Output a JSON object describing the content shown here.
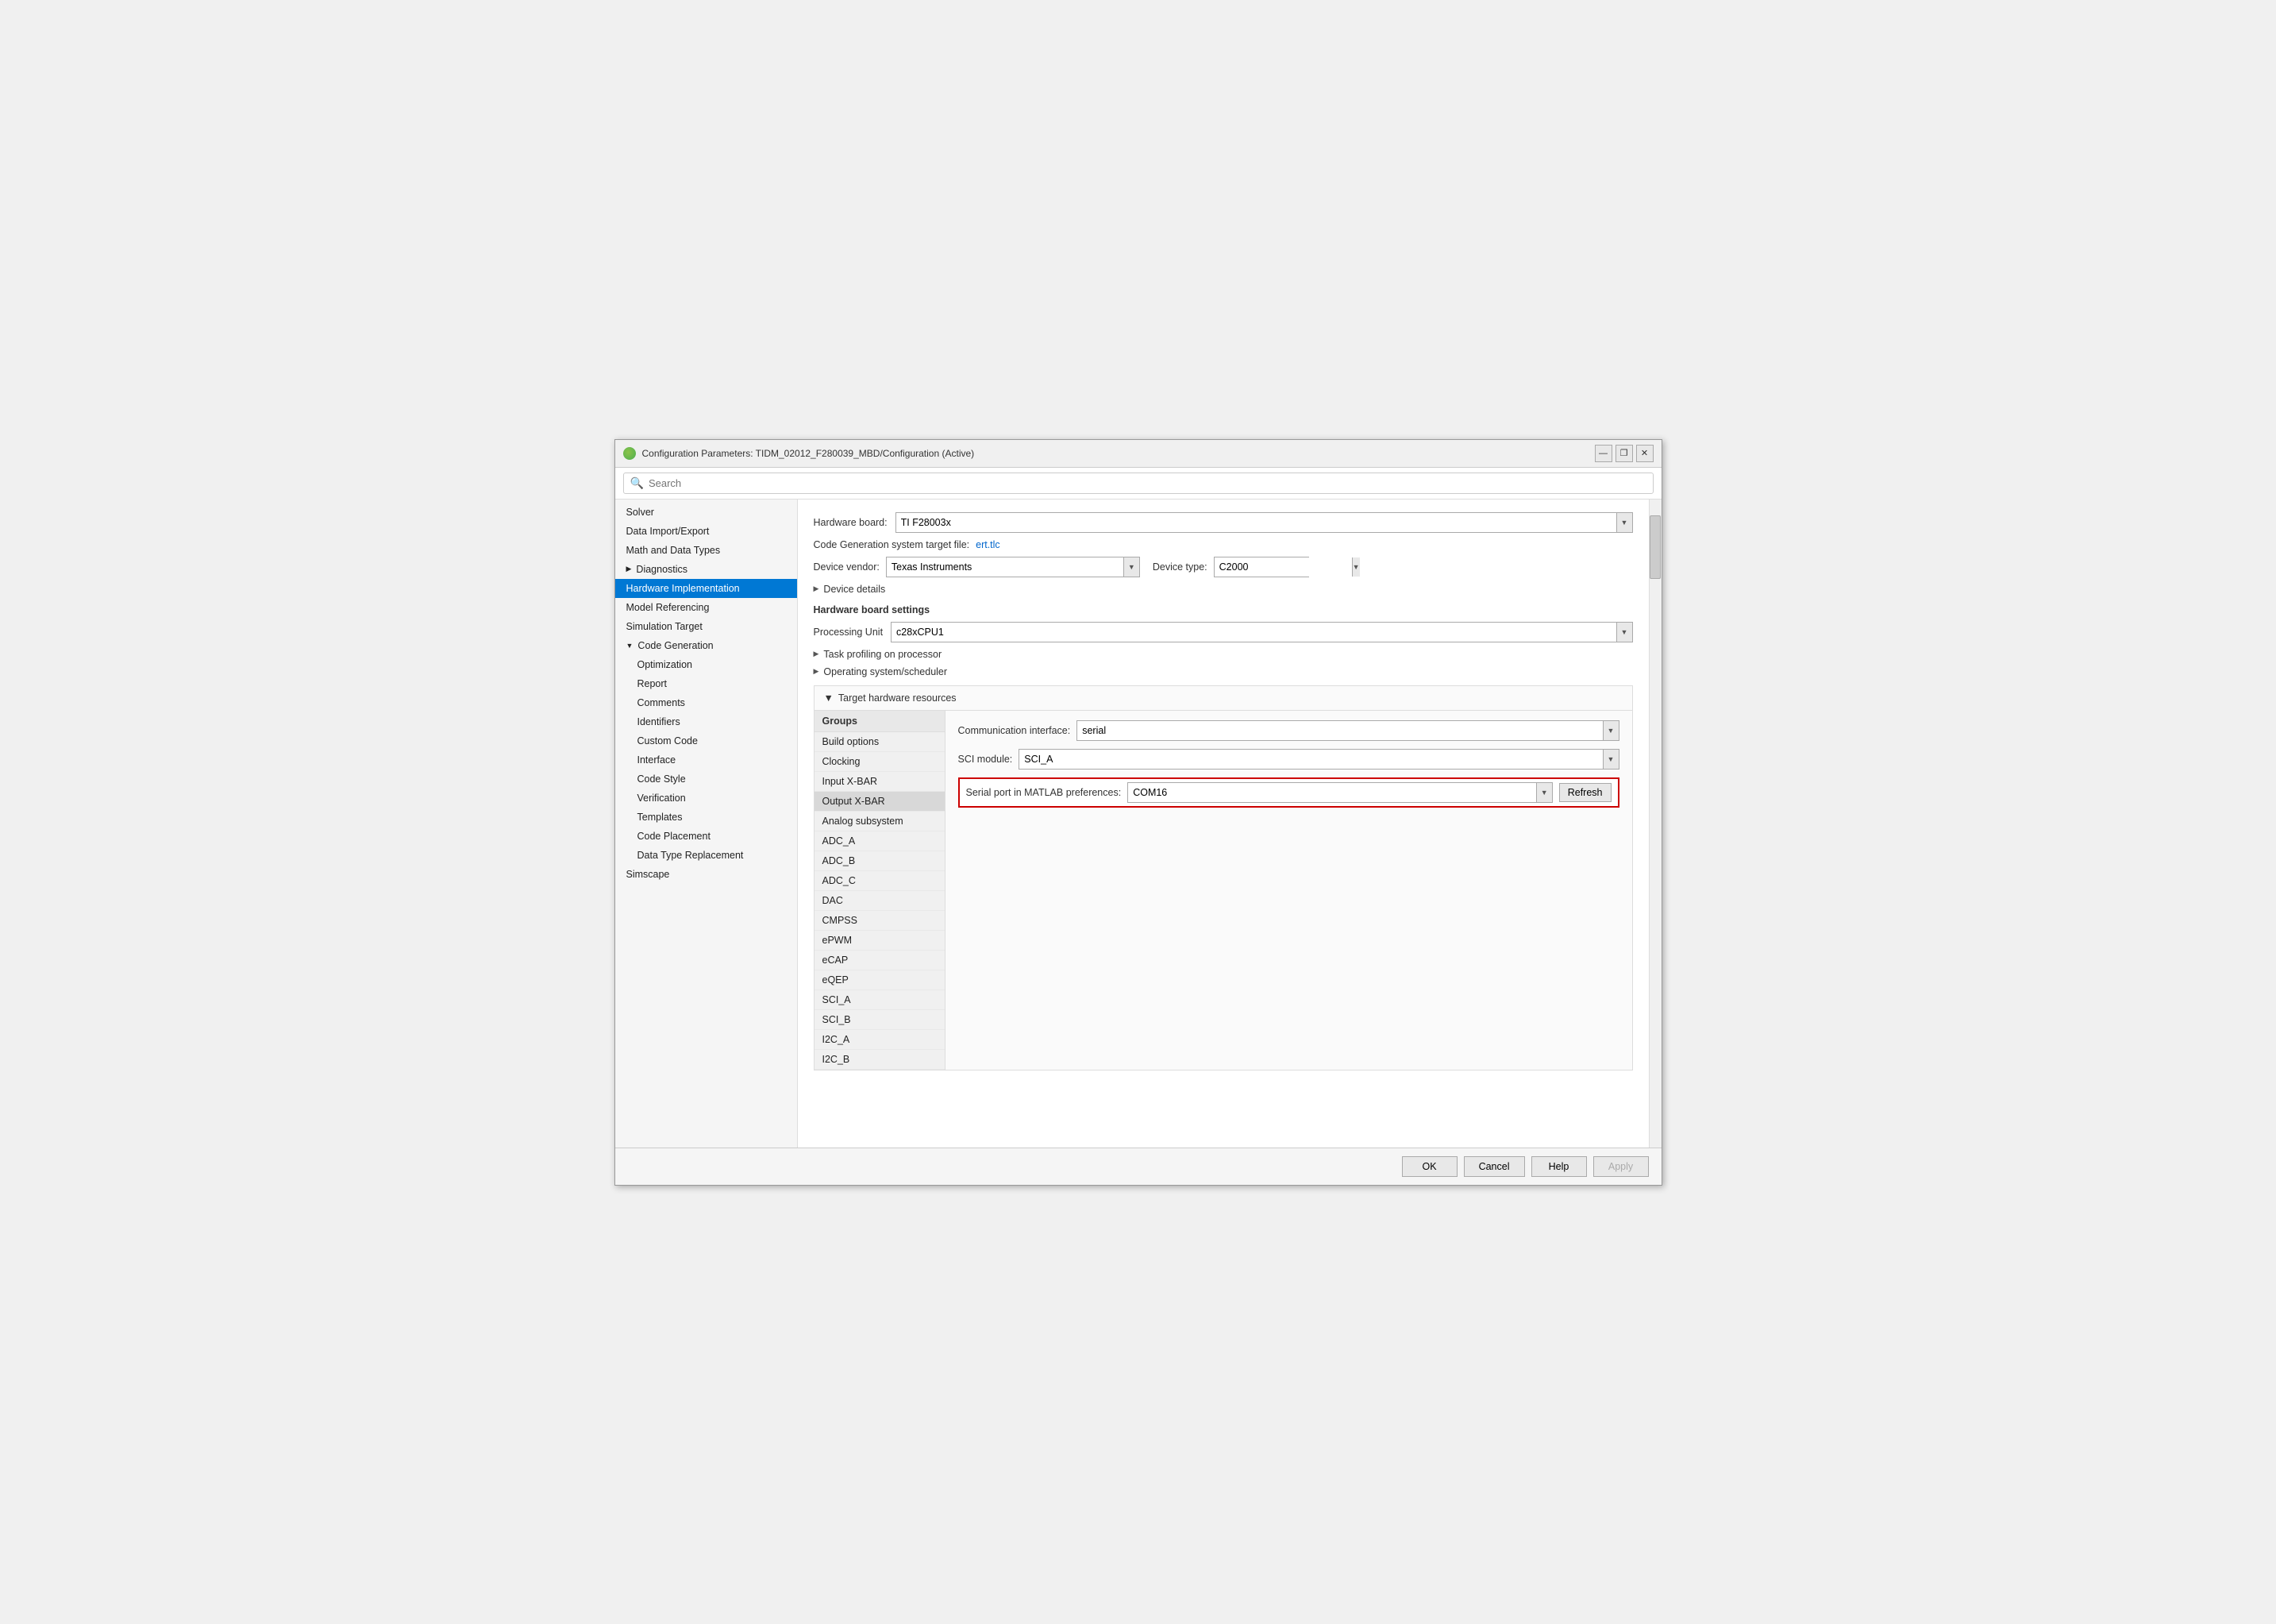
{
  "window": {
    "title": "Configuration Parameters: TIDM_02012_F280039_MBD/Configuration (Active)",
    "minimize": "—",
    "restore": "❐",
    "close": "✕"
  },
  "search": {
    "placeholder": "Search"
  },
  "sidebar": {
    "items": [
      {
        "id": "solver",
        "label": "Solver",
        "indent": 1,
        "active": false
      },
      {
        "id": "data-import-export",
        "label": "Data Import/Export",
        "indent": 1,
        "active": false
      },
      {
        "id": "math-data-types",
        "label": "Math and Data Types",
        "indent": 1,
        "active": false
      },
      {
        "id": "diagnostics",
        "label": "Diagnostics",
        "indent": 1,
        "active": false,
        "triangle": "▶"
      },
      {
        "id": "hardware-implementation",
        "label": "Hardware Implementation",
        "indent": 1,
        "active": true
      },
      {
        "id": "model-referencing",
        "label": "Model Referencing",
        "indent": 1,
        "active": false
      },
      {
        "id": "simulation-target",
        "label": "Simulation Target",
        "indent": 1,
        "active": false
      },
      {
        "id": "code-generation",
        "label": "Code Generation",
        "indent": 1,
        "active": false,
        "triangle": "▼"
      },
      {
        "id": "optimization",
        "label": "Optimization",
        "indent": 2,
        "active": false
      },
      {
        "id": "report",
        "label": "Report",
        "indent": 2,
        "active": false
      },
      {
        "id": "comments",
        "label": "Comments",
        "indent": 2,
        "active": false
      },
      {
        "id": "identifiers",
        "label": "Identifiers",
        "indent": 2,
        "active": false
      },
      {
        "id": "custom-code",
        "label": "Custom Code",
        "indent": 2,
        "active": false
      },
      {
        "id": "interface",
        "label": "Interface",
        "indent": 2,
        "active": false
      },
      {
        "id": "code-style",
        "label": "Code Style",
        "indent": 2,
        "active": false
      },
      {
        "id": "verification",
        "label": "Verification",
        "indent": 2,
        "active": false
      },
      {
        "id": "templates",
        "label": "Templates",
        "indent": 2,
        "active": false
      },
      {
        "id": "code-placement",
        "label": "Code Placement",
        "indent": 2,
        "active": false
      },
      {
        "id": "data-type-replacement",
        "label": "Data Type Replacement",
        "indent": 2,
        "active": false
      },
      {
        "id": "simscape",
        "label": "Simscape",
        "indent": 1,
        "active": false
      }
    ]
  },
  "content": {
    "hardware_board_label": "Hardware board:",
    "hardware_board_value": "TI F28003x",
    "code_gen_label": "Code Generation system target file:",
    "code_gen_link": "ert.tlc",
    "device_vendor_label": "Device vendor:",
    "device_vendor_value": "Texas Instruments",
    "device_type_label": "Device type:",
    "device_type_value": "C2000",
    "device_details_label": "Device details",
    "hw_board_settings_label": "Hardware board settings",
    "processing_unit_label": "Processing Unit",
    "processing_unit_value": "c28xCPU1",
    "task_profiling_label": "Task profiling on processor",
    "os_scheduler_label": "Operating system/scheduler",
    "target_hw_label": "Target hardware resources",
    "groups_title": "Groups",
    "groups": [
      {
        "id": "build-options",
        "label": "Build options"
      },
      {
        "id": "clocking",
        "label": "Clocking"
      },
      {
        "id": "input-xbar",
        "label": "Input X-BAR"
      },
      {
        "id": "output-xbar",
        "label": "Output X-BAR",
        "active": true
      },
      {
        "id": "analog-subsystem",
        "label": "Analog subsystem"
      },
      {
        "id": "adc-a",
        "label": "ADC_A"
      },
      {
        "id": "adc-b",
        "label": "ADC_B"
      },
      {
        "id": "adc-c",
        "label": "ADC_C"
      },
      {
        "id": "dac",
        "label": "DAC"
      },
      {
        "id": "cmpss",
        "label": "CMPSS"
      },
      {
        "id": "epwm",
        "label": "ePWM"
      },
      {
        "id": "ecap",
        "label": "eCAP"
      },
      {
        "id": "eqep",
        "label": "eQEP"
      },
      {
        "id": "sci-a",
        "label": "SCI_A"
      },
      {
        "id": "sci-b",
        "label": "SCI_B"
      },
      {
        "id": "i2c-a",
        "label": "I2C_A"
      },
      {
        "id": "i2c-b",
        "label": "I2C_B"
      }
    ],
    "comm_interface_label": "Communication interface:",
    "comm_interface_value": "serial",
    "sci_module_label": "SCI module:",
    "sci_module_value": "SCI_A",
    "serial_port_label": "Serial port in MATLAB preferences:",
    "serial_port_value": "COM16",
    "refresh_label": "Refresh"
  },
  "bottom_bar": {
    "ok_label": "OK",
    "cancel_label": "Cancel",
    "help_label": "Help",
    "apply_label": "Apply"
  }
}
